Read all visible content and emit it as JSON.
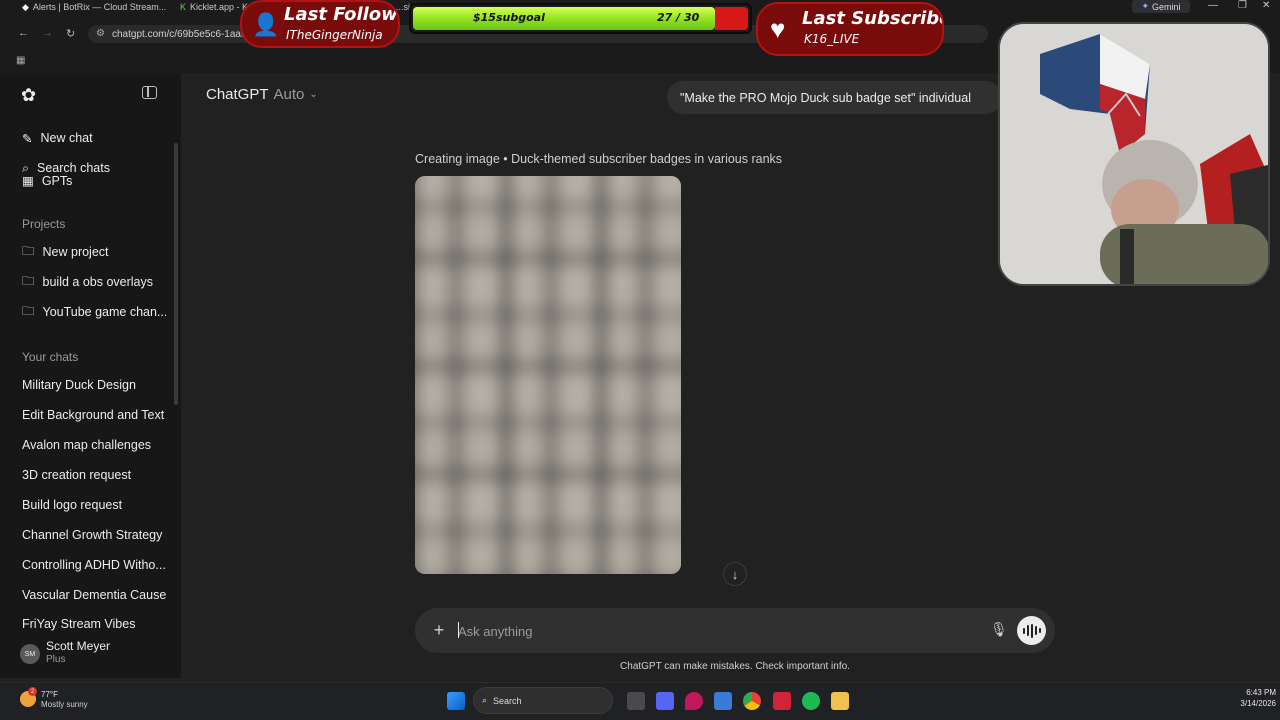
{
  "browser": {
    "tabs": [
      {
        "label": "Alerts | BotRix — Cloud Stream..."
      },
      {
        "label": "Kicklet.app - K..."
      },
      {
        "label": "...sign"
      }
    ],
    "address": "chatgpt.com/c/69b5e5c6-1aac-",
    "gemini_label": "Gemini"
  },
  "sidebar": {
    "top_items": [
      {
        "label": "New chat",
        "icon": "pencil-square-icon"
      },
      {
        "label": "Search chats",
        "icon": "search-icon"
      },
      {
        "label": "GPTs",
        "icon": "grid-icon"
      }
    ],
    "projects_header": "Projects",
    "projects": [
      {
        "label": "New project",
        "icon": "folder-plus-icon"
      },
      {
        "label": "build a obs overlays",
        "icon": "folder-icon"
      },
      {
        "label": "YouTube game chan...",
        "icon": "folder-icon"
      }
    ],
    "chats_header": "Your chats",
    "chats": [
      {
        "label": "Military Duck Design"
      },
      {
        "label": "Edit Background and Text"
      },
      {
        "label": "Avalon map challenges"
      },
      {
        "label": "3D creation request"
      },
      {
        "label": "Build logo request"
      },
      {
        "label": "Channel Growth Strategy"
      },
      {
        "label": "Controlling ADHD Witho..."
      },
      {
        "label": "Vascular Dementia Causes"
      },
      {
        "label": "FriYay Stream Vibes"
      }
    ],
    "user": {
      "initials": "SM",
      "name": "Scott Meyer",
      "plan": "Plus"
    }
  },
  "header": {
    "title": "ChatGPT",
    "model": "Auto"
  },
  "conversation": {
    "user_message": "\"Make the PRO Mojo Duck sub badge set\" individual",
    "status": "Creating image • Duck-themed subscriber badges in various ranks"
  },
  "composer": {
    "placeholder": "Ask anything",
    "disclaimer": "ChatGPT can make mistakes. Check important info."
  },
  "taskbar": {
    "weather_temp": "77°F",
    "weather_desc": "Mostly sunny",
    "weather_badge": "2",
    "search_label": "Search",
    "time": "6:43 PM",
    "date": "3/14/2026"
  },
  "overlay": {
    "last_follower_title": "Last Follower",
    "last_follower_name": "ITheGingerNinja",
    "goal_label": "$15subgoal",
    "goal_count": "27 / 30",
    "goal_progress": 0.9,
    "last_subscriber_title": "Last Subscriber",
    "last_subscriber_name": "K16_LIVE"
  },
  "colors": {
    "app_bg": "#212121",
    "sidebar_bg": "#171717",
    "composer_bg": "#303030",
    "overlay_red": "#7a0b0b",
    "goal_green": "#8fe11a"
  }
}
